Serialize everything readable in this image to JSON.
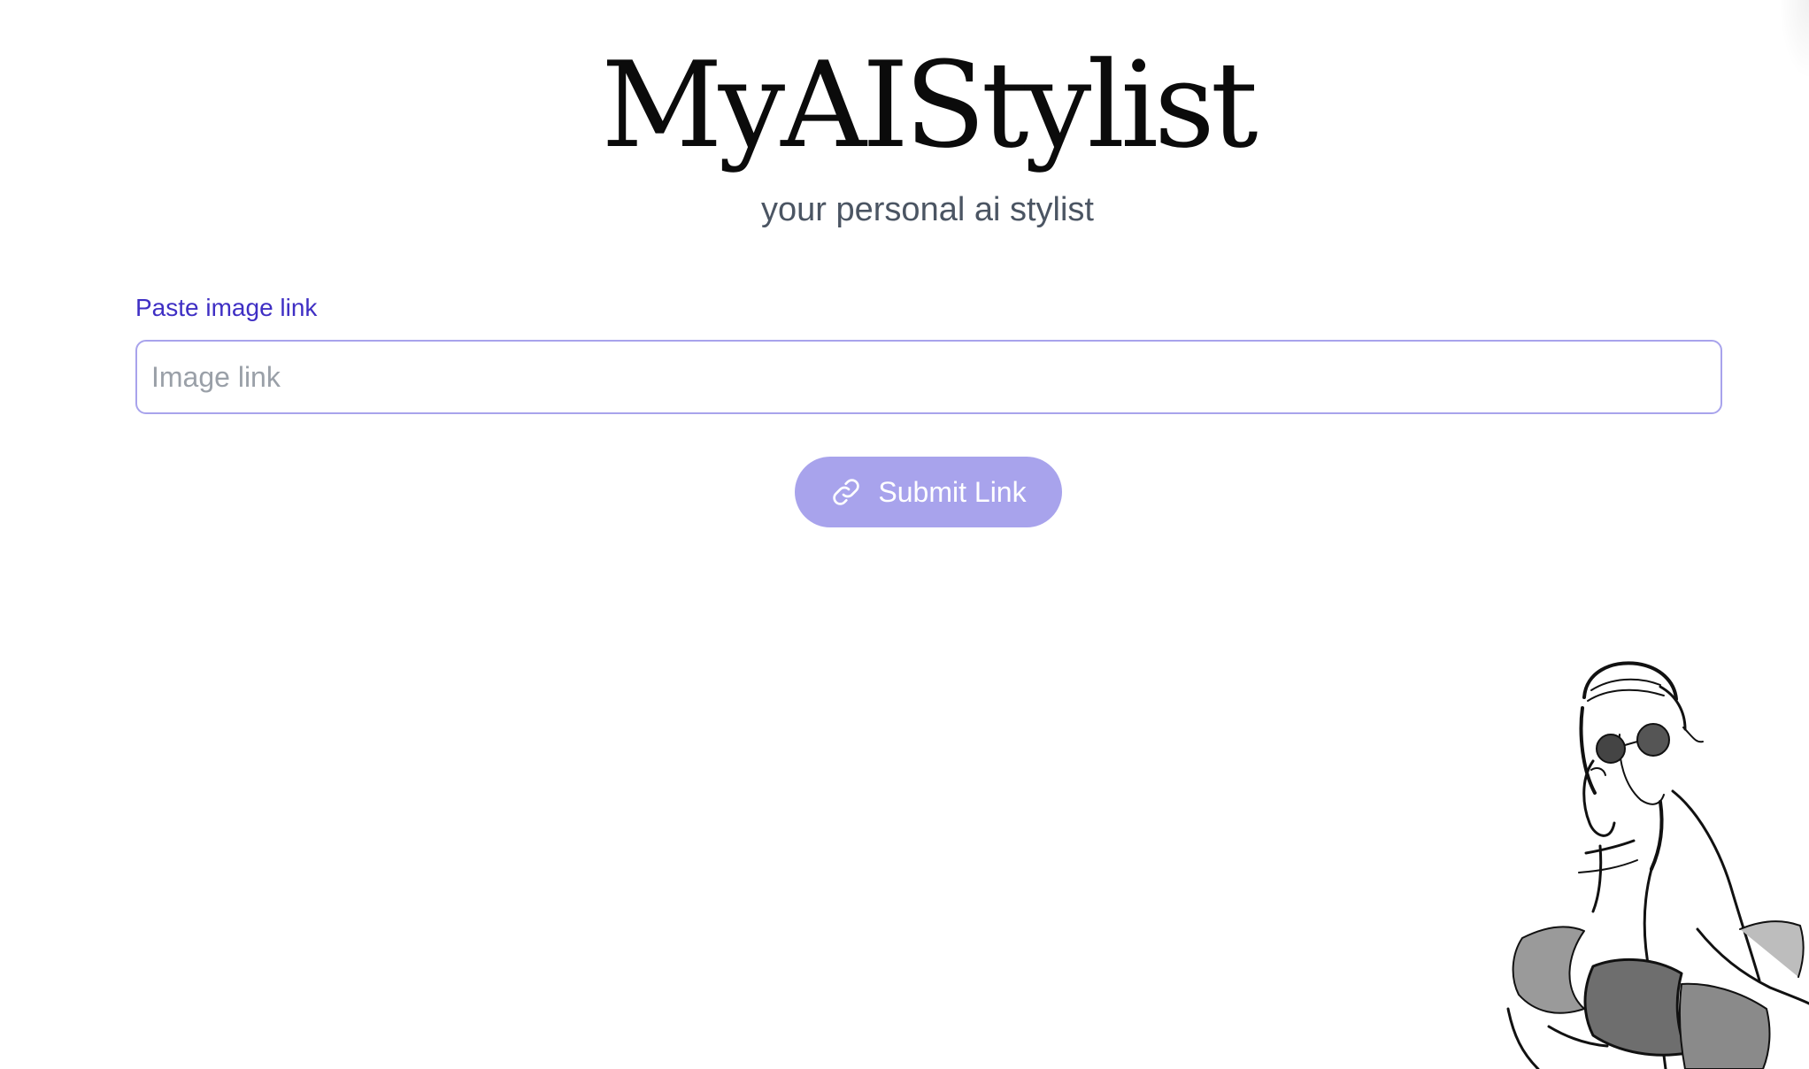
{
  "header": {
    "title": "MyAIStylist",
    "subtitle": "your personal ai stylist"
  },
  "form": {
    "label": "Paste image link",
    "input_placeholder": "Image link",
    "input_value": "",
    "submit_label": "Submit Link",
    "submit_icon": "link-icon"
  },
  "illustration": {
    "icon": "fashion-sketch-illustration"
  },
  "colors": {
    "accent": "#a8a3ec",
    "label": "#3f2fc4",
    "subtitle": "#4b5563",
    "title": "#0b0b0b"
  }
}
